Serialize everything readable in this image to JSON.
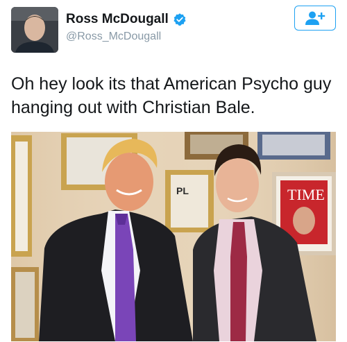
{
  "user": {
    "display_name": "Ross McDougall",
    "handle": "@Ross_McDougall",
    "verified": true
  },
  "follow_button": {
    "icon": "add-user-icon",
    "color": "#1da1f2"
  },
  "tweet": {
    "text": "Oh hey look its that American Psycho guy hanging out with Christian Bale."
  },
  "photo": {
    "magazine_title": "TIME",
    "poster_letters": "PL"
  }
}
